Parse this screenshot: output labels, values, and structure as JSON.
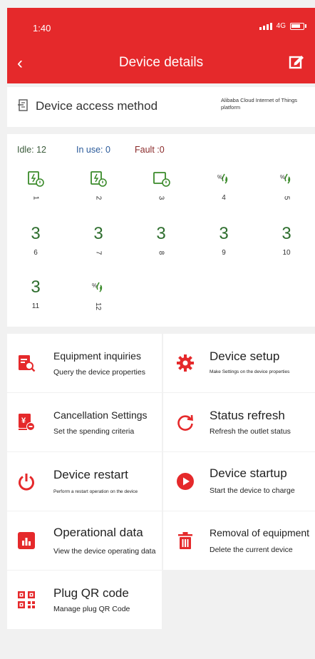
{
  "status": {
    "time": "1:40",
    "network": "4G"
  },
  "header": {
    "title": "Device details"
  },
  "access": {
    "label": "Device access method",
    "value": "Alibaba Cloud Internet of Things platform"
  },
  "stats": {
    "idle": "Idle: 12",
    "in_use": "In use: 0",
    "fault": "Fault :0"
  },
  "outlets": [
    {
      "number": "1",
      "display": "icon",
      "rotated": true
    },
    {
      "number": "2",
      "display": "icon",
      "rotated": true
    },
    {
      "number": "3",
      "display": "icon",
      "rotated": true
    },
    {
      "number": "4",
      "display": "icon",
      "rotated": false
    },
    {
      "number": "5",
      "display": "icon",
      "rotated": true
    },
    {
      "number": "6",
      "display": "3",
      "rotated": false
    },
    {
      "number": "7",
      "display": "3",
      "rotated": true
    },
    {
      "number": "8",
      "display": "3",
      "rotated": true
    },
    {
      "number": "9",
      "display": "3",
      "rotated": false
    },
    {
      "number": "10",
      "display": "3",
      "rotated": false
    },
    {
      "number": "11",
      "display": "3",
      "rotated": false
    },
    {
      "number": "12",
      "display": "icon",
      "rotated": true
    }
  ],
  "menu": [
    {
      "title": "Equipment inquiries",
      "subtitle": "Query the device properties",
      "icon": "document-search-icon"
    },
    {
      "title": "Device setup",
      "subtitle": "Make Settings on the device properties",
      "icon": "gear-icon"
    },
    {
      "title": "Cancellation Settings",
      "subtitle": "Set the spending criteria",
      "icon": "yen-document-icon"
    },
    {
      "title": "Status refresh",
      "subtitle": "Refresh the outlet status",
      "icon": "refresh-icon"
    },
    {
      "title": "Device restart",
      "subtitle": "Perform a restart operation on the device",
      "icon": "power-icon"
    },
    {
      "title": "Device startup",
      "subtitle": "Start the device to charge",
      "icon": "play-icon"
    },
    {
      "title": "Operational data",
      "subtitle": "View the device operating data",
      "icon": "bar-chart-icon"
    },
    {
      "title": "Removal of equipment",
      "subtitle": "Delete the current device",
      "icon": "trash-icon"
    },
    {
      "title": "Plug QR code",
      "subtitle": "Manage plug QR Code",
      "icon": "qr-code-icon"
    }
  ],
  "colors": {
    "primary": "#e5292b",
    "outlet_green": "#3a8a2a",
    "in_use": "#2a5a9a",
    "fault": "#8a2a2a"
  }
}
